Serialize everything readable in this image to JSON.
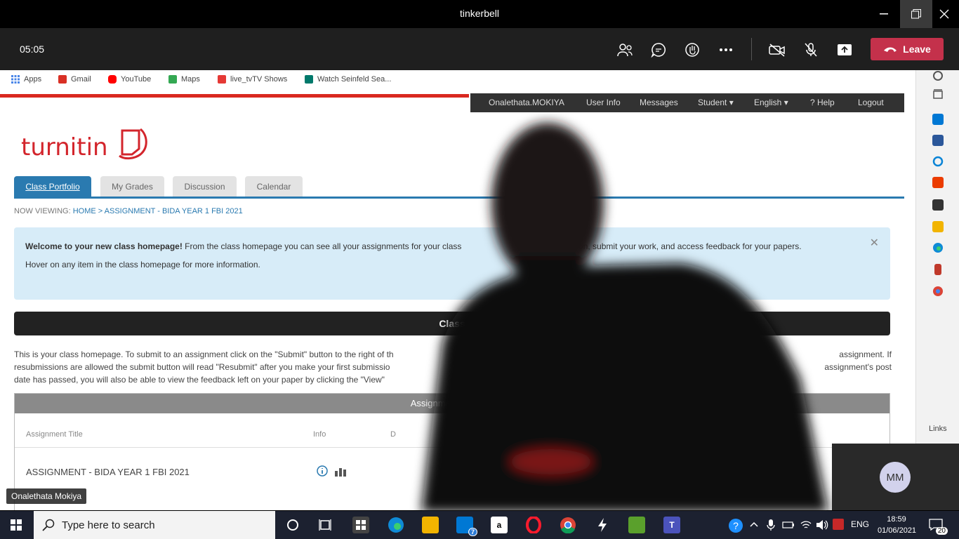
{
  "window": {
    "title": "tinkerbell"
  },
  "meeting": {
    "timer": "05:05",
    "leave_label": "Leave",
    "participant_initials": "MM",
    "speaker_name": "Onalethata Mokiya"
  },
  "browser": {
    "bookmarks": [
      {
        "label": "Apps",
        "color": "#4a86e8"
      },
      {
        "label": "Gmail",
        "color": "#d93025"
      },
      {
        "label": "YouTube",
        "color": "#ff0000"
      },
      {
        "label": "Maps",
        "color": "#34a853"
      },
      {
        "label": "live_tvTV Shows",
        "color": "#e53935"
      },
      {
        "label": "Watch Seinfeld Sea...",
        "color": "#00796b"
      }
    ],
    "sidebar_links_label": "Links"
  },
  "turnitin": {
    "logo_text": "turnitin",
    "topnav": [
      "Onalethata.MOKIYA",
      "User Info",
      "Messages",
      "Student ▾",
      "English ▾",
      "? Help",
      "Logout"
    ],
    "tabs": [
      "Class Portfolio",
      "My Grades",
      "Discussion",
      "Calendar"
    ],
    "crumb_label": "NOW VIEWING:",
    "crumb_path": "HOME > ASSIGNMENT - BIDA YEAR 1 FBI 2021",
    "welcome_bold": "Welcome to your new class homepage!",
    "welcome_text": " From the class homepage you can see all your assignments for your class",
    "welcome_text_tail": "rmation, submit your work, and access feedback for your papers.",
    "welcome_hover": "Hover on any item in the class homepage for more information.",
    "class_bar": "Class",
    "class_text_1": "This is your class homepage. To submit to an assignment click on the \"Submit\" button to the right of th",
    "class_text_1_tail": "assignment. If",
    "class_text_2": "resubmissions are allowed the submit button will read \"Resubmit\" after you make your first submissio",
    "class_text_2_tail": "assignment's post",
    "class_text_3": "date has passed, you will also be able to view the feedback left on your paper by clicking the \"View\"",
    "inbox_header": "Assignment Inbox: A",
    "col_title": "Assignment Title",
    "col_info": "Info",
    "col_d": "D",
    "row_title": "ASSIGNMENT - BIDA YEAR 1 FBI 2021"
  },
  "taskbar": {
    "search_placeholder": "Type here to search",
    "mail_badge": "7",
    "language": "ENG",
    "time": "18:59",
    "date": "01/06/2021",
    "notifications": "20"
  }
}
